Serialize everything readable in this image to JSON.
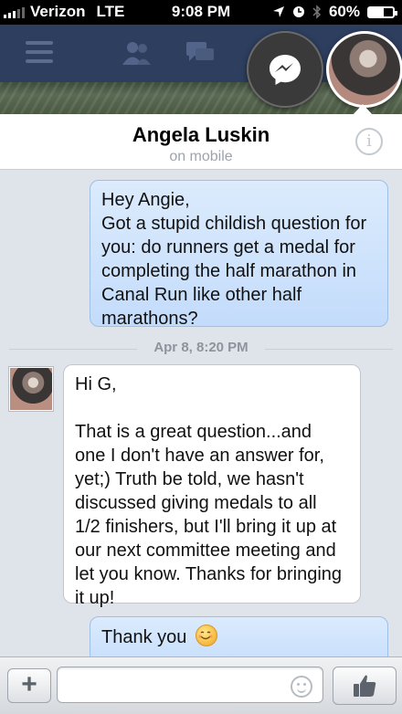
{
  "status_bar": {
    "carrier": "Verizon",
    "network": "LTE",
    "time": "9:08 PM",
    "battery": "60%",
    "battery_level": 0.6
  },
  "navbar": {
    "icons": [
      "menu-icon",
      "friends-icon",
      "messages-icon",
      "messenger-icon"
    ]
  },
  "conversation": {
    "name": "Angela Luskin",
    "status": "on mobile"
  },
  "messages": {
    "m1": {
      "direction": "outgoing",
      "lines": [
        "Hey Angie,",
        "Got a stupid childish question for",
        "you: do runners get a medal for",
        "completing the half marathon in",
        "Canal Run like other half",
        "marathons?"
      ]
    },
    "timestamp": "Apr 8, 8:20 PM",
    "m2": {
      "direction": "incoming",
      "lines": [
        "Hi G,",
        "",
        "That is a great question...and",
        "one I don't have an answer for,",
        "yet;) Truth be told, we hasn't",
        "discussed giving medals to all",
        "1/2 finishers, but I'll bring it up at",
        "our next committee meeting and",
        "let you know. Thanks for bringing",
        "it up!"
      ]
    },
    "m3": {
      "direction": "outgoing",
      "text": "Thank you",
      "emoji": "smiling-face"
    }
  },
  "composer": {
    "add_label": "+",
    "input_value": "",
    "input_placeholder": ""
  },
  "colors": {
    "outgoing_bubble": "#c9e0fc",
    "incoming_bubble": "#ffffff",
    "navbar": "#2d3e5e",
    "background": "#dfe3ea"
  }
}
